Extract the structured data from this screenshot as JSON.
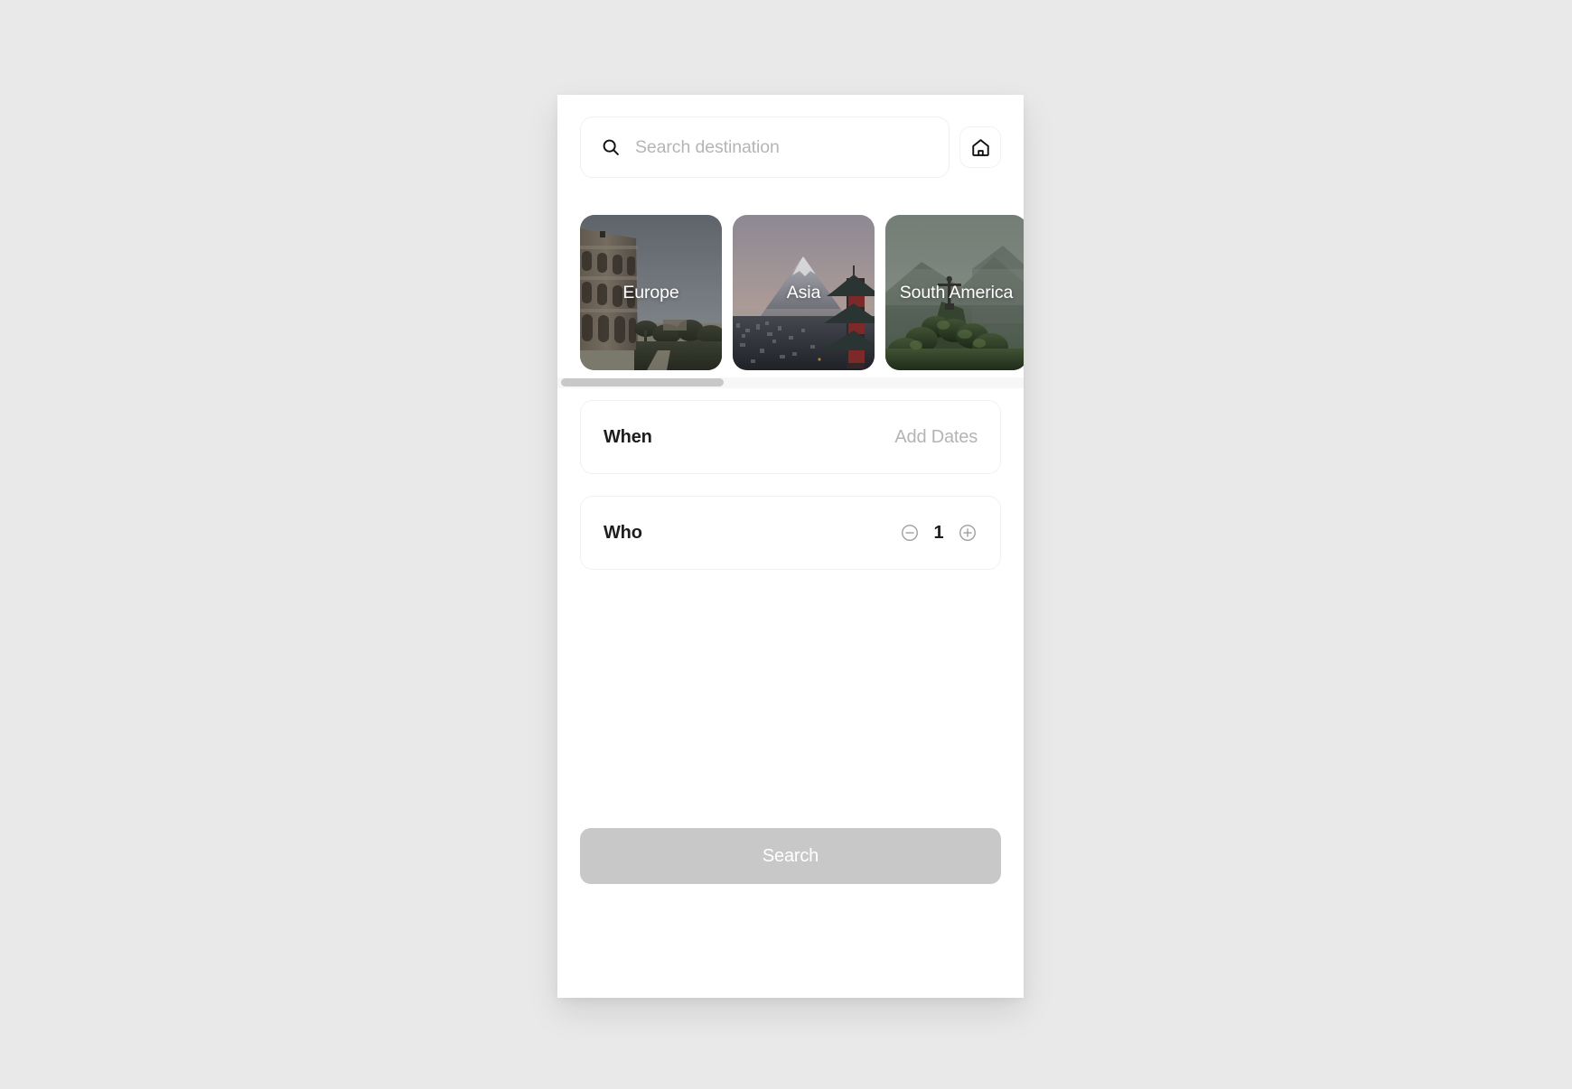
{
  "search": {
    "placeholder": "Search destination",
    "value": "",
    "icon": "search-icon",
    "home_button_icon": "home-icon"
  },
  "destinations": [
    {
      "label": "Europe",
      "scene": "colosseum-rome"
    },
    {
      "label": "Asia",
      "scene": "mount-fuji-pagoda"
    },
    {
      "label": "South America",
      "scene": "christ-the-redeemer-rio"
    }
  ],
  "options": [
    {
      "label": "When",
      "value": "Add Dates"
    }
  ],
  "guests": {
    "label": "Who",
    "count": "1",
    "decrement_icon": "circle-minus-icon",
    "increment_icon": "circle-plus-icon"
  },
  "footer": {
    "search_label": "Search"
  },
  "colors": {
    "page_background": "#e9e9e9",
    "panel_background": "#ffffff",
    "muted_text": "#b4b4b4",
    "primary_text": "#1d1d1d",
    "disabled_button": "#c8c8c8",
    "scrollbar_thumb": "#c8c8c8"
  }
}
